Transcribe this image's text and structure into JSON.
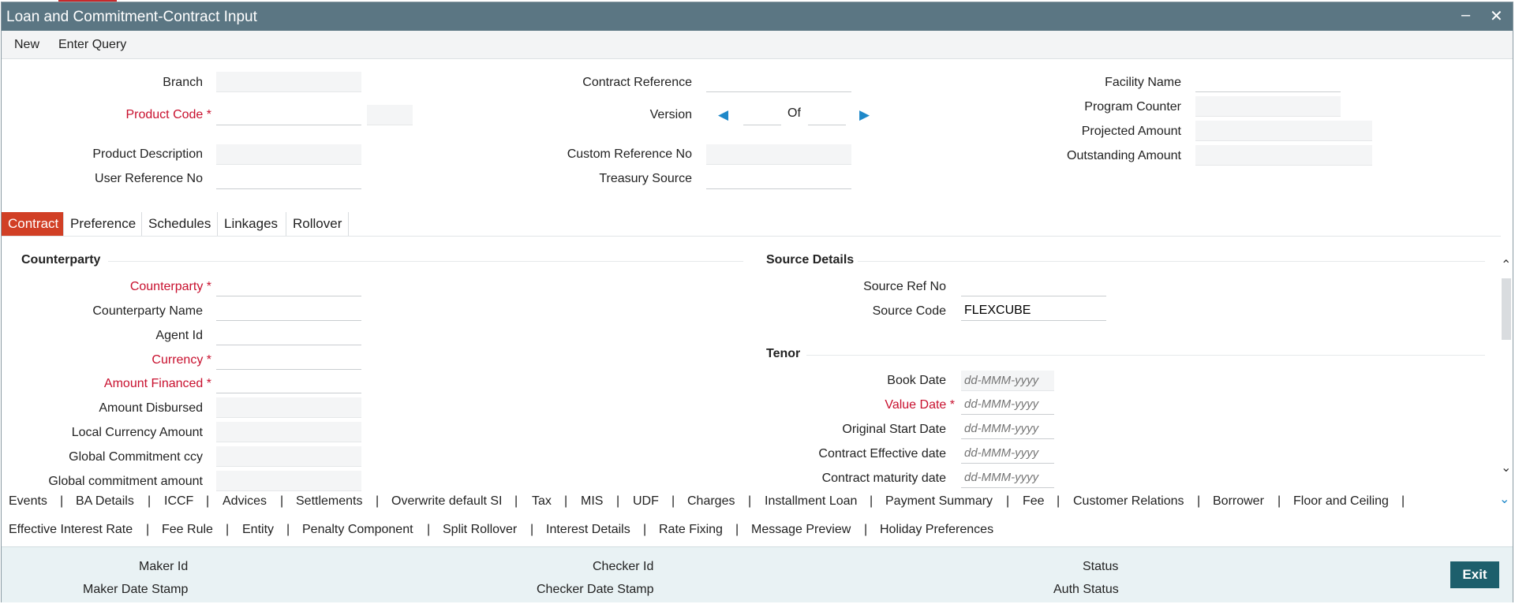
{
  "window": {
    "title": "Loan and Commitment-Contract Input"
  },
  "toolbar": {
    "new_label": "New",
    "enter_query_label": "Enter Query"
  },
  "header": {
    "branch_label": "Branch",
    "product_code_label": "Product Code",
    "product_description_label": "Product Description",
    "user_reference_no_label": "User Reference No",
    "contract_reference_label": "Contract Reference",
    "version_label": "Version",
    "of_label": "Of",
    "custom_reference_no_label": "Custom Reference No",
    "treasury_source_label": "Treasury Source",
    "facility_name_label": "Facility Name",
    "program_counter_label": "Program Counter",
    "projected_amount_label": "Projected Amount",
    "outstanding_amount_label": "Outstanding Amount"
  },
  "tabs": [
    "Contract",
    "Preference",
    "Schedules",
    "Linkages",
    "Rollover"
  ],
  "counterparty": {
    "section_title": "Counterparty",
    "counterparty_label": "Counterparty",
    "counterparty_name_label": "Counterparty Name",
    "agent_id_label": "Agent Id",
    "currency_label": "Currency",
    "amount_financed_label": "Amount Financed",
    "amount_disbursed_label": "Amount Disbursed",
    "local_currency_amount_label": "Local Currency Amount",
    "global_commitment_ccy_label": "Global Commitment ccy",
    "global_commitment_amount_label": "Global commitment amount"
  },
  "source": {
    "section_title": "Source Details",
    "source_ref_no_label": "Source Ref No",
    "source_code_label": "Source Code",
    "source_code_value": "FLEXCUBE"
  },
  "tenor": {
    "section_title": "Tenor",
    "book_date_label": "Book Date",
    "value_date_label": "Value Date",
    "original_start_date_label": "Original Start Date",
    "contract_effective_date_label": "Contract Effective date",
    "contract_maturity_date_label": "Contract maturity date",
    "date_placeholder": "dd-MMM-yyyy"
  },
  "links_row1": [
    "Events",
    "BA Details",
    "ICCF",
    "Advices",
    "Settlements",
    "Overwrite default SI",
    "Tax",
    "MIS",
    "UDF",
    "Charges",
    "Installment Loan",
    "Payment Summary",
    "Fee",
    "Customer Relations",
    "Borrower",
    "Floor and Ceiling"
  ],
  "links_row2": [
    "Effective Interest Rate",
    "Fee Rule",
    "Entity",
    "Penalty Component",
    "Split Rollover",
    "Interest Details",
    "Rate Fixing",
    "Message Preview",
    "Holiday Preferences"
  ],
  "footer": {
    "maker_id_label": "Maker Id",
    "maker_date_stamp_label": "Maker Date Stamp",
    "checker_id_label": "Checker Id",
    "checker_date_stamp_label": "Checker Date Stamp",
    "status_label": "Status",
    "auth_status_label": "Auth Status",
    "exit_label": "Exit"
  },
  "colors": {
    "titlebar": "#5b7683",
    "active_tab": "#d13f25",
    "required": "#c8102e",
    "exit_button": "#1d5f6c",
    "footer": "#e9f2f4"
  },
  "icons": [
    "minimize-icon",
    "close-icon",
    "prev-arrow-icon",
    "next-arrow-icon",
    "scroll-up-icon",
    "scroll-down-icon",
    "expand-links-icon"
  ]
}
